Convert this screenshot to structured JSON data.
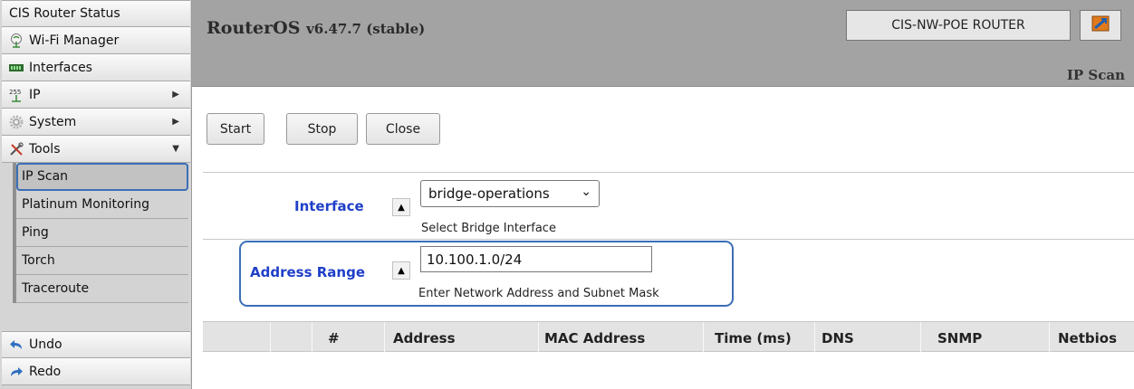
{
  "sidebar": {
    "items": [
      {
        "label": "CIS Router Status",
        "icon": "none"
      },
      {
        "label": "Wi-Fi Manager",
        "icon": "wifi-icon"
      },
      {
        "label": "Interfaces",
        "icon": "interfaces-icon"
      },
      {
        "label": "IP",
        "icon": "ip-icon",
        "icon_text": "255",
        "arrow": "▶"
      },
      {
        "label": "System",
        "icon": "gear-icon",
        "arrow": "▶"
      },
      {
        "label": "Tools",
        "icon": "tools-icon",
        "arrow": "▼"
      }
    ],
    "tools_submenu": [
      {
        "label": "IP Scan",
        "active": true
      },
      {
        "label": "Platinum Monitoring"
      },
      {
        "label": "Ping"
      },
      {
        "label": "Torch"
      },
      {
        "label": "Traceroute"
      }
    ],
    "bottom": [
      {
        "label": "Undo",
        "icon": "undo-icon"
      },
      {
        "label": "Redo",
        "icon": "redo-icon"
      }
    ]
  },
  "header": {
    "title": "RouterOS",
    "version": "v6.47.7 (stable)",
    "router_name": "CIS-NW-POE ROUTER",
    "page_title": "IP Scan"
  },
  "toolbar": {
    "start_label": "Start",
    "stop_label": "Stop",
    "close_label": "Close"
  },
  "form": {
    "interface": {
      "label": "Interface",
      "value": "bridge-operations",
      "hint": "Select Bridge Interface"
    },
    "address_range": {
      "label": "Address Range",
      "value": "10.100.1.0/24",
      "hint": "Enter Network Address and Subnet Mask"
    }
  },
  "table": {
    "columns": [
      "#",
      "Address",
      "MAC Address",
      "Time (ms)",
      "DNS",
      "SNMP",
      "Netbios"
    ]
  },
  "colors": {
    "label_blue": "#1f3fc8",
    "highlight_blue": "#3b6fb6",
    "header_gray": "#a3a3a3"
  }
}
